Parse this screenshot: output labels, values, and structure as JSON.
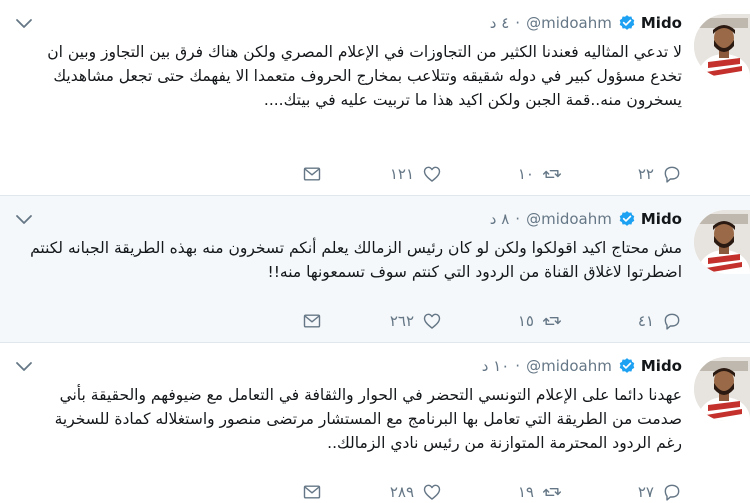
{
  "tweets": [
    {
      "name": "Mido",
      "handle": "@midoahm",
      "time": "٤ د",
      "text": "لا تدعي المثاليه فعندنا الكثير من التجاوزات في الإعلام المصري ولكن هناك فرق بين التجاوز وبين ان تخدع مسؤول كبير في دوله شقيقه وتتلاعب بمخارج الحروف متعمدا الا يفهمك حتى تجعل مشاهديك يسخرون منه..قمة الجبن ولكن اكيد هذا ما تربيت عليه في بيتك....",
      "replies": "٢٢",
      "retweets": "١٠",
      "likes": "١٢١"
    },
    {
      "name": "Mido",
      "handle": "@midoahm",
      "time": "٨ د",
      "text": "مش محتاج اكيد اقولكوا ولكن لو كان رئيس الزمالك يعلم أنكم تسخرون منه بهذه الطريقة الجبانه لكنتم اضطرتوا لاغلاق القناة من الردود التي كنتم سوف تسمعونها منه!!",
      "replies": "٤١",
      "retweets": "١٥",
      "likes": "٢٦٢"
    },
    {
      "name": "Mido",
      "handle": "@midoahm",
      "time": "١٠ د",
      "text": "عهدنا دائما على الإعلام التونسي التحضر في الحوار والثقافة في التعامل مع ضيوفهم والحقيقة بأني صدمت من الطريقة التي تعامل بها البرنامج مع المستشار مرتضى منصور واستغلاله كمادة للسخرية رغم الردود المحترمة المتوازنة من رئيس نادي الزمالك..",
      "replies": "٢٧",
      "retweets": "١٩",
      "likes": "٢٨٩"
    }
  ],
  "colors": {
    "verified": "#1da1f2",
    "meta": "#657786",
    "highlight_bg": "#f5f8fa",
    "divider": "#e1e8ed"
  },
  "icons": [
    "reply-icon",
    "retweet-icon",
    "like-icon",
    "dm-icon",
    "chevron-down-icon",
    "verified-badge-icon"
  ]
}
